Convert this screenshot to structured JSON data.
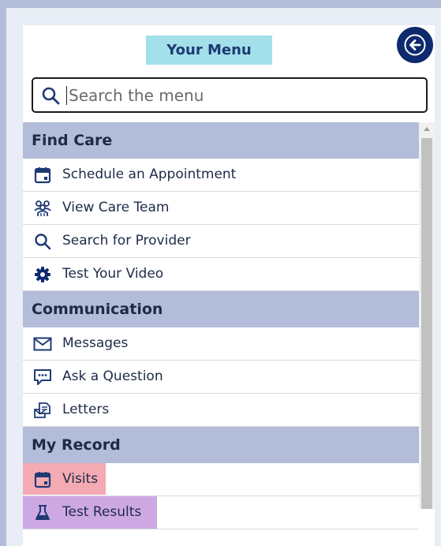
{
  "header": {
    "title": "Your Menu",
    "back_icon": "arrow-left-icon"
  },
  "search": {
    "placeholder": "Search the menu",
    "icon": "search-icon"
  },
  "sections": [
    {
      "title": "Find Care",
      "items": [
        {
          "label": "Schedule an Appointment",
          "icon": "calendar-icon"
        },
        {
          "label": "View Care Team",
          "icon": "care-team-icon"
        },
        {
          "label": "Search for Provider",
          "icon": "search-icon"
        },
        {
          "label": "Test Your Video",
          "icon": "gear-icon"
        }
      ]
    },
    {
      "title": "Communication",
      "items": [
        {
          "label": "Messages",
          "icon": "envelope-icon"
        },
        {
          "label": "Ask a Question",
          "icon": "chat-bubble-icon"
        },
        {
          "label": "Letters",
          "icon": "letters-icon"
        }
      ]
    },
    {
      "title": "My Record",
      "items": [
        {
          "label": "Visits",
          "icon": "calendar-icon",
          "highlight": "#f4aab2"
        },
        {
          "label": "Test Results",
          "icon": "flask-icon",
          "highlight": "#cda8e3"
        }
      ]
    }
  ],
  "colors": {
    "page_background": "#b3bdd9",
    "section_header": "#b3bdd9",
    "title_badge": "#a3e0ea",
    "accent_navy": "#0d2a6e",
    "icon_navy": "#1f3a75"
  }
}
